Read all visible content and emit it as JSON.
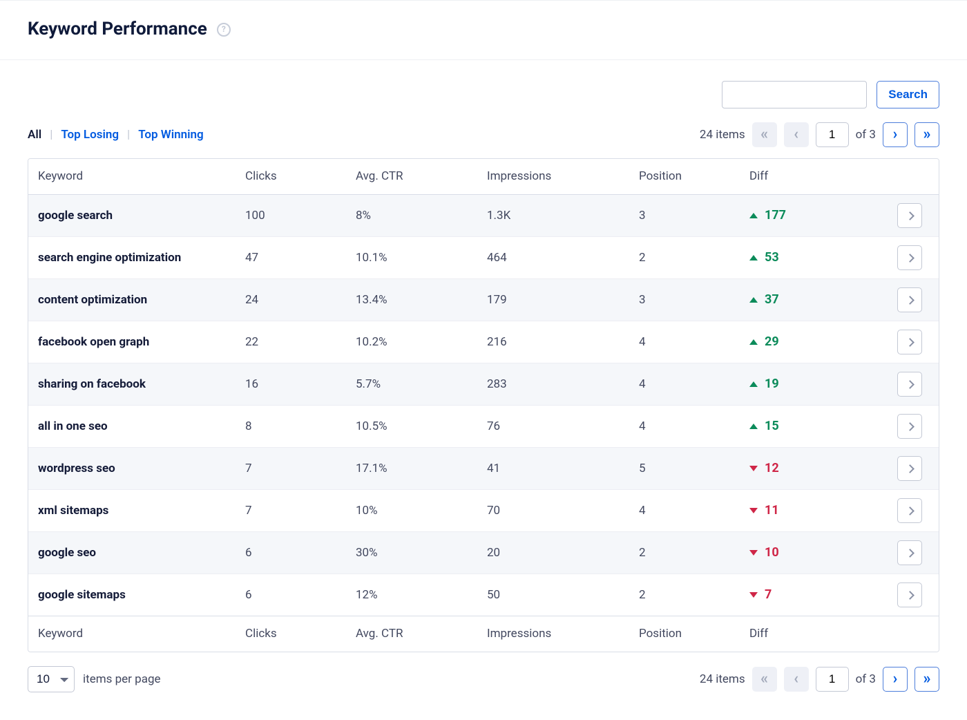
{
  "header": {
    "title": "Keyword Performance"
  },
  "search": {
    "value": "",
    "button_label": "Search"
  },
  "tabs": {
    "all": "All",
    "top_losing": "Top Losing",
    "top_winning": "Top Winning",
    "active": "all",
    "separator": "|"
  },
  "pagination": {
    "items_label": "24 items",
    "page": "1",
    "of_label": "of 3"
  },
  "columns": {
    "keyword": "Keyword",
    "clicks": "Clicks",
    "ctr": "Avg. CTR",
    "impressions": "Impressions",
    "position": "Position",
    "diff": "Diff"
  },
  "rows": [
    {
      "keyword": "google search",
      "clicks": "100",
      "ctr": "8%",
      "impr": "1.3K",
      "pos": "3",
      "diff_dir": "up",
      "diff": "177"
    },
    {
      "keyword": "search engine optimization",
      "clicks": "47",
      "ctr": "10.1%",
      "impr": "464",
      "pos": "2",
      "diff_dir": "up",
      "diff": "53"
    },
    {
      "keyword": "content optimization",
      "clicks": "24",
      "ctr": "13.4%",
      "impr": "179",
      "pos": "3",
      "diff_dir": "up",
      "diff": "37"
    },
    {
      "keyword": "facebook open graph",
      "clicks": "22",
      "ctr": "10.2%",
      "impr": "216",
      "pos": "4",
      "diff_dir": "up",
      "diff": "29"
    },
    {
      "keyword": "sharing on facebook",
      "clicks": "16",
      "ctr": "5.7%",
      "impr": "283",
      "pos": "4",
      "diff_dir": "up",
      "diff": "19"
    },
    {
      "keyword": "all in one seo",
      "clicks": "8",
      "ctr": "10.5%",
      "impr": "76",
      "pos": "4",
      "diff_dir": "up",
      "diff": "15"
    },
    {
      "keyword": "wordpress seo",
      "clicks": "7",
      "ctr": "17.1%",
      "impr": "41",
      "pos": "5",
      "diff_dir": "down",
      "diff": "12"
    },
    {
      "keyword": "xml sitemaps",
      "clicks": "7",
      "ctr": "10%",
      "impr": "70",
      "pos": "4",
      "diff_dir": "down",
      "diff": "11"
    },
    {
      "keyword": "google seo",
      "clicks": "6",
      "ctr": "30%",
      "impr": "20",
      "pos": "2",
      "diff_dir": "down",
      "diff": "10"
    },
    {
      "keyword": "google sitemaps",
      "clicks": "6",
      "ctr": "12%",
      "impr": "50",
      "pos": "2",
      "diff_dir": "down",
      "diff": "7"
    }
  ],
  "items_per_page": {
    "value": "10",
    "label": "items per page"
  }
}
